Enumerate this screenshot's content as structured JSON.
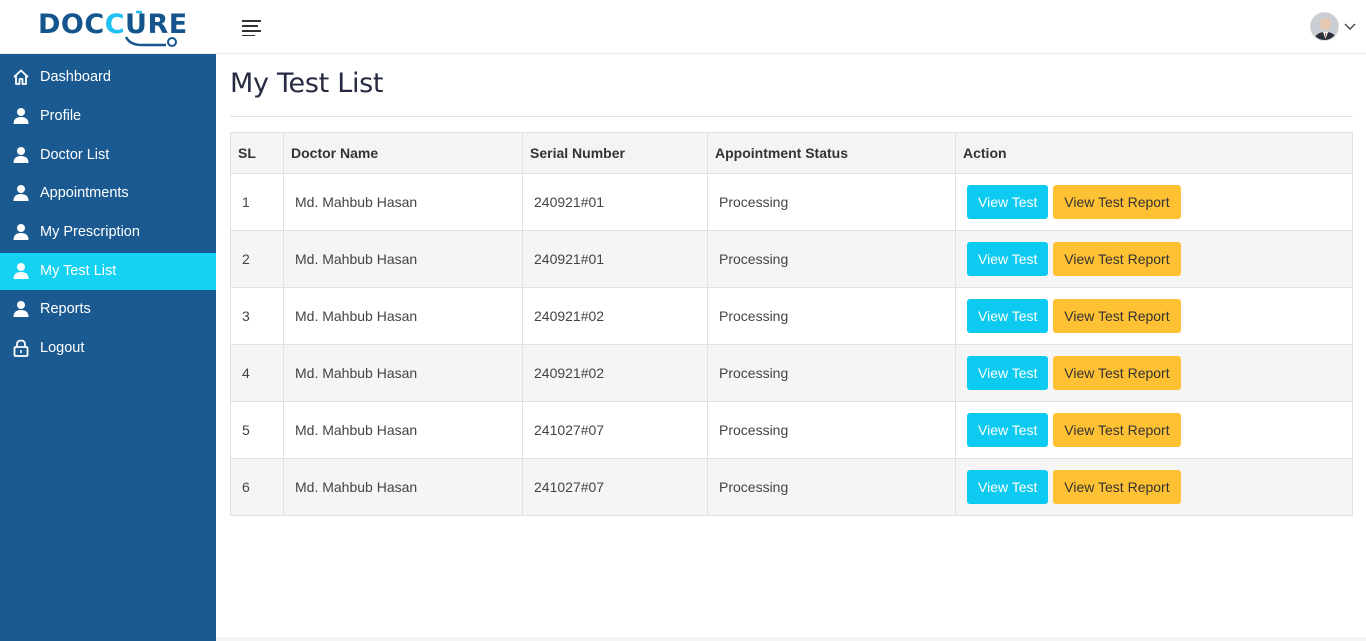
{
  "brand": {
    "logo_part1": "DOC",
    "logo_part2": "C",
    "logo_part3": "U",
    "logo_part4": "RE",
    "primary_color": "#15558d",
    "accent_color": "#20c0f3"
  },
  "sidebar": {
    "items": [
      {
        "label": "Dashboard",
        "icon": "home-icon",
        "active": false
      },
      {
        "label": "Profile",
        "icon": "user-icon",
        "active": false
      },
      {
        "label": "Doctor List",
        "icon": "user-icon",
        "active": false
      },
      {
        "label": "Appointments",
        "icon": "user-icon",
        "active": false
      },
      {
        "label": "My Prescription",
        "icon": "user-icon",
        "active": false
      },
      {
        "label": "My Test List",
        "icon": "user-icon",
        "active": true
      },
      {
        "label": "Reports",
        "icon": "user-icon",
        "active": false
      },
      {
        "label": "Logout",
        "icon": "lock-icon",
        "active": false
      }
    ]
  },
  "main": {
    "title": "My Test List",
    "table": {
      "headers": [
        "SL",
        "Doctor Name",
        "Serial Number",
        "Appointment Status",
        "Action"
      ],
      "rows": [
        {
          "sl": "1",
          "doctor": "Md. Mahbub Hasan",
          "serial": "240921#01",
          "status": "Processing"
        },
        {
          "sl": "2",
          "doctor": "Md. Mahbub Hasan",
          "serial": "240921#01",
          "status": "Processing"
        },
        {
          "sl": "3",
          "doctor": "Md. Mahbub Hasan",
          "serial": "240921#02",
          "status": "Processing"
        },
        {
          "sl": "4",
          "doctor": "Md. Mahbub Hasan",
          "serial": "240921#02",
          "status": "Processing"
        },
        {
          "sl": "5",
          "doctor": "Md. Mahbub Hasan",
          "serial": "241027#07",
          "status": "Processing"
        },
        {
          "sl": "6",
          "doctor": "Md. Mahbub Hasan",
          "serial": "241027#07",
          "status": "Processing"
        }
      ],
      "view_test_label": "View Test",
      "view_report_label": "View Test Report"
    }
  },
  "colors": {
    "sidebar_bg": "#1b5a90",
    "active_item": "#15d1f2",
    "btn_info": "#0dcaf0",
    "btn_warning": "#ffc134"
  }
}
